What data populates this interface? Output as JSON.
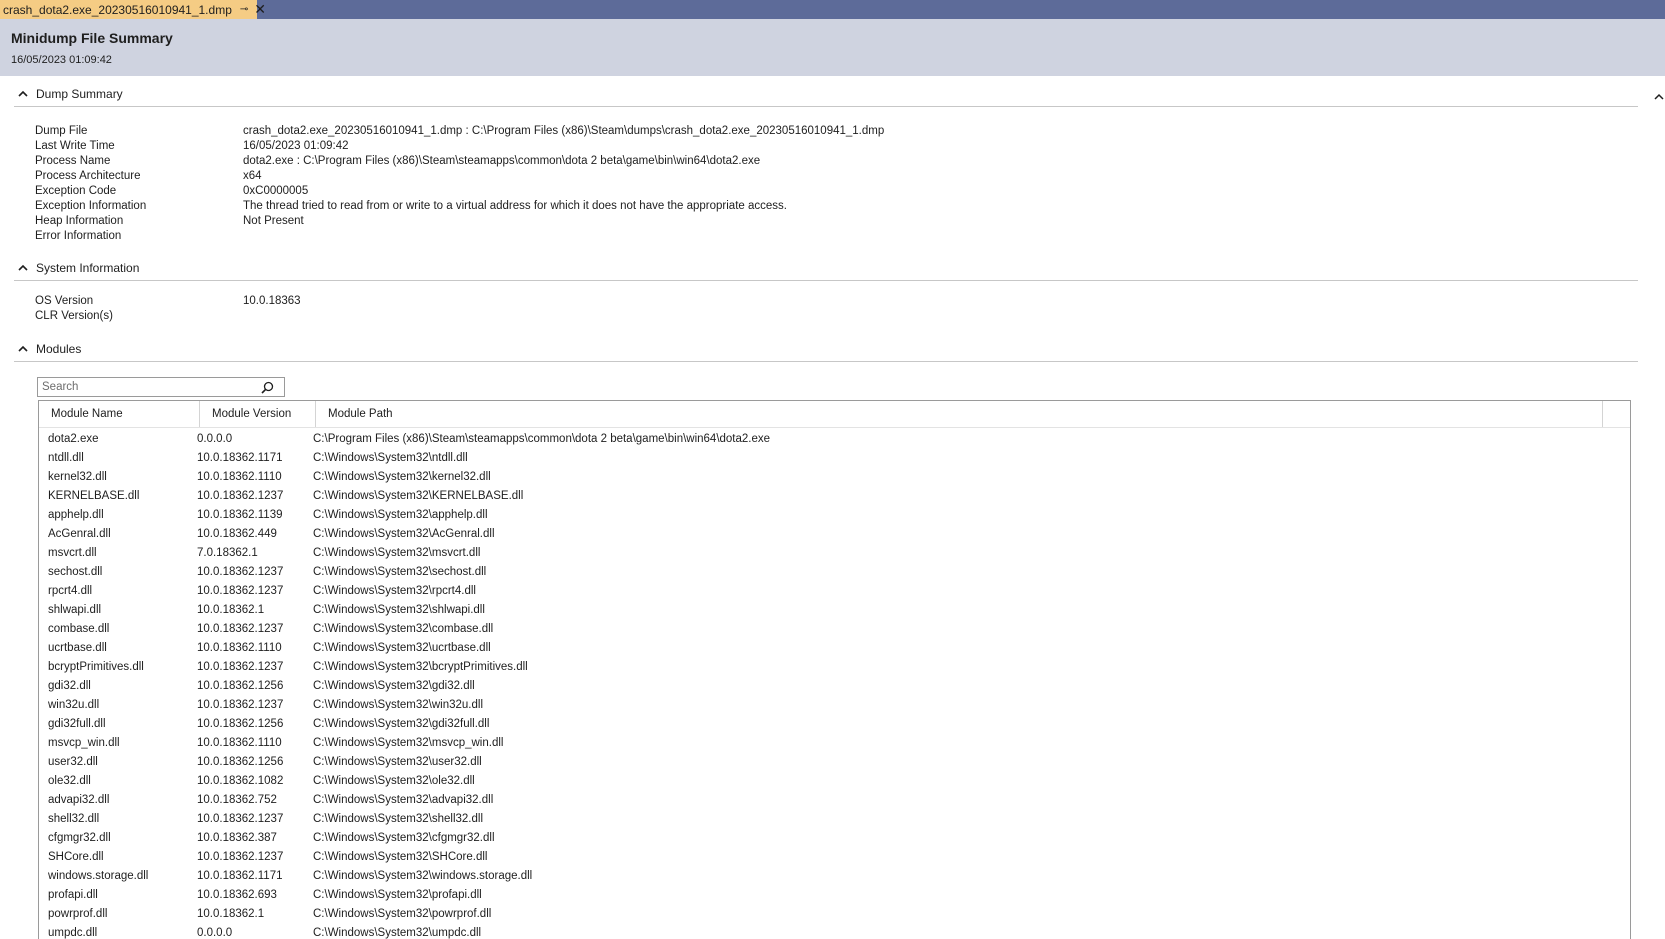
{
  "tab": {
    "title": "crash_dota2.exe_20230516010941_1.dmp",
    "pin_glyph": "⊸",
    "close_glyph": "✕"
  },
  "header": {
    "title": "Minidump File Summary",
    "timestamp": "16/05/2023 01:09:42"
  },
  "dump_summary": {
    "heading": "Dump Summary",
    "rows": [
      {
        "key": "Dump File",
        "value": "crash_dota2.exe_20230516010941_1.dmp : C:\\Program Files (x86)\\Steam\\dumps\\crash_dota2.exe_20230516010941_1.dmp"
      },
      {
        "key": "Last Write Time",
        "value": "16/05/2023 01:09:42"
      },
      {
        "key": "Process Name",
        "value": "dota2.exe : C:\\Program Files (x86)\\Steam\\steamapps\\common\\dota 2 beta\\game\\bin\\win64\\dota2.exe"
      },
      {
        "key": "Process Architecture",
        "value": "x64"
      },
      {
        "key": "Exception Code",
        "value": "0xC0000005"
      },
      {
        "key": "Exception Information",
        "value": "The thread tried to read from or write to a virtual address for which it does not have the appropriate access."
      },
      {
        "key": "Heap Information",
        "value": "Not Present"
      },
      {
        "key": "Error Information",
        "value": ""
      }
    ]
  },
  "system_information": {
    "heading": "System Information",
    "rows": [
      {
        "key": "OS Version",
        "value": "10.0.18363"
      },
      {
        "key": "CLR Version(s)",
        "value": ""
      }
    ]
  },
  "modules": {
    "heading": "Modules",
    "search_placeholder": "Search",
    "columns": [
      "Module Name",
      "Module Version",
      "Module Path"
    ],
    "rows": [
      [
        "dota2.exe",
        "0.0.0.0",
        "C:\\Program Files (x86)\\Steam\\steamapps\\common\\dota 2 beta\\game\\bin\\win64\\dota2.exe"
      ],
      [
        "ntdll.dll",
        "10.0.18362.1171",
        "C:\\Windows\\System32\\ntdll.dll"
      ],
      [
        "kernel32.dll",
        "10.0.18362.1110",
        "C:\\Windows\\System32\\kernel32.dll"
      ],
      [
        "KERNELBASE.dll",
        "10.0.18362.1237",
        "C:\\Windows\\System32\\KERNELBASE.dll"
      ],
      [
        "apphelp.dll",
        "10.0.18362.1139",
        "C:\\Windows\\System32\\apphelp.dll"
      ],
      [
        "AcGenral.dll",
        "10.0.18362.449",
        "C:\\Windows\\System32\\AcGenral.dll"
      ],
      [
        "msvcrt.dll",
        "7.0.18362.1",
        "C:\\Windows\\System32\\msvcrt.dll"
      ],
      [
        "sechost.dll",
        "10.0.18362.1237",
        "C:\\Windows\\System32\\sechost.dll"
      ],
      [
        "rpcrt4.dll",
        "10.0.18362.1237",
        "C:\\Windows\\System32\\rpcrt4.dll"
      ],
      [
        "shlwapi.dll",
        "10.0.18362.1",
        "C:\\Windows\\System32\\shlwapi.dll"
      ],
      [
        "combase.dll",
        "10.0.18362.1237",
        "C:\\Windows\\System32\\combase.dll"
      ],
      [
        "ucrtbase.dll",
        "10.0.18362.1110",
        "C:\\Windows\\System32\\ucrtbase.dll"
      ],
      [
        "bcryptPrimitives.dll",
        "10.0.18362.1237",
        "C:\\Windows\\System32\\bcryptPrimitives.dll"
      ],
      [
        "gdi32.dll",
        "10.0.18362.1256",
        "C:\\Windows\\System32\\gdi32.dll"
      ],
      [
        "win32u.dll",
        "10.0.18362.1237",
        "C:\\Windows\\System32\\win32u.dll"
      ],
      [
        "gdi32full.dll",
        "10.0.18362.1256",
        "C:\\Windows\\System32\\gdi32full.dll"
      ],
      [
        "msvcp_win.dll",
        "10.0.18362.1110",
        "C:\\Windows\\System32\\msvcp_win.dll"
      ],
      [
        "user32.dll",
        "10.0.18362.1256",
        "C:\\Windows\\System32\\user32.dll"
      ],
      [
        "ole32.dll",
        "10.0.18362.1082",
        "C:\\Windows\\System32\\ole32.dll"
      ],
      [
        "advapi32.dll",
        "10.0.18362.752",
        "C:\\Windows\\System32\\advapi32.dll"
      ],
      [
        "shell32.dll",
        "10.0.18362.1237",
        "C:\\Windows\\System32\\shell32.dll"
      ],
      [
        "cfgmgr32.dll",
        "10.0.18362.387",
        "C:\\Windows\\System32\\cfgmgr32.dll"
      ],
      [
        "SHCore.dll",
        "10.0.18362.1237",
        "C:\\Windows\\System32\\SHCore.dll"
      ],
      [
        "windows.storage.dll",
        "10.0.18362.1171",
        "C:\\Windows\\System32\\windows.storage.dll"
      ],
      [
        "profapi.dll",
        "10.0.18362.693",
        "C:\\Windows\\System32\\profapi.dll"
      ],
      [
        "powrprof.dll",
        "10.0.18362.1",
        "C:\\Windows\\System32\\powrprof.dll"
      ],
      [
        "umpdc.dll",
        "0.0.0.0",
        "C:\\Windows\\System32\\umpdc.dll"
      ]
    ]
  },
  "colors": {
    "tabbar": "#5d6b99",
    "active_tab": "#f5cc84",
    "header_band": "#cfd3e0"
  }
}
